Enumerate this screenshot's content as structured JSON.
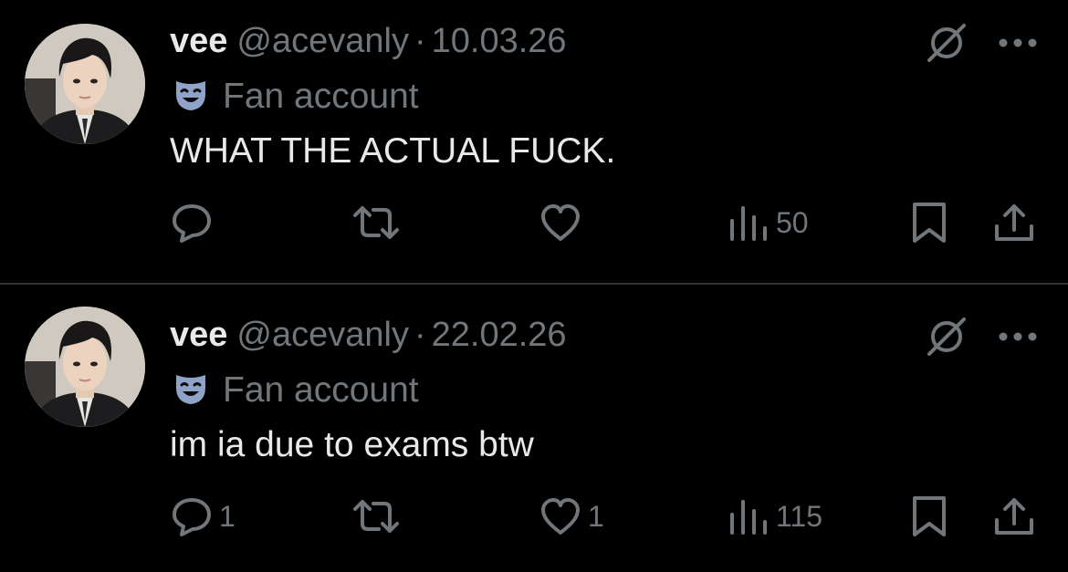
{
  "posts": [
    {
      "author": {
        "display_name": "vee",
        "handle": "@acevanly",
        "separator": "·",
        "date": "10.03.26",
        "badge_label": "Fan account",
        "badge_icon": "theater-mask-icon"
      },
      "text": "WHAT THE ACTUAL FUCK.",
      "actions": {
        "reply_count": "",
        "repost_count": "",
        "like_count": "",
        "views_count": "50"
      }
    },
    {
      "author": {
        "display_name": "vee",
        "handle": "@acevanly",
        "separator": "·",
        "date": "22.02.26",
        "badge_label": "Fan account",
        "badge_icon": "theater-mask-icon"
      },
      "text": "im ia due to exams btw",
      "actions": {
        "reply_count": "1",
        "repost_count": "",
        "like_count": "1",
        "views_count": "115"
      }
    }
  ],
  "theme": {
    "background": "#000000",
    "primary_text": "#e7e9ea",
    "secondary_text": "#71767b",
    "divider": "#2f3336"
  }
}
